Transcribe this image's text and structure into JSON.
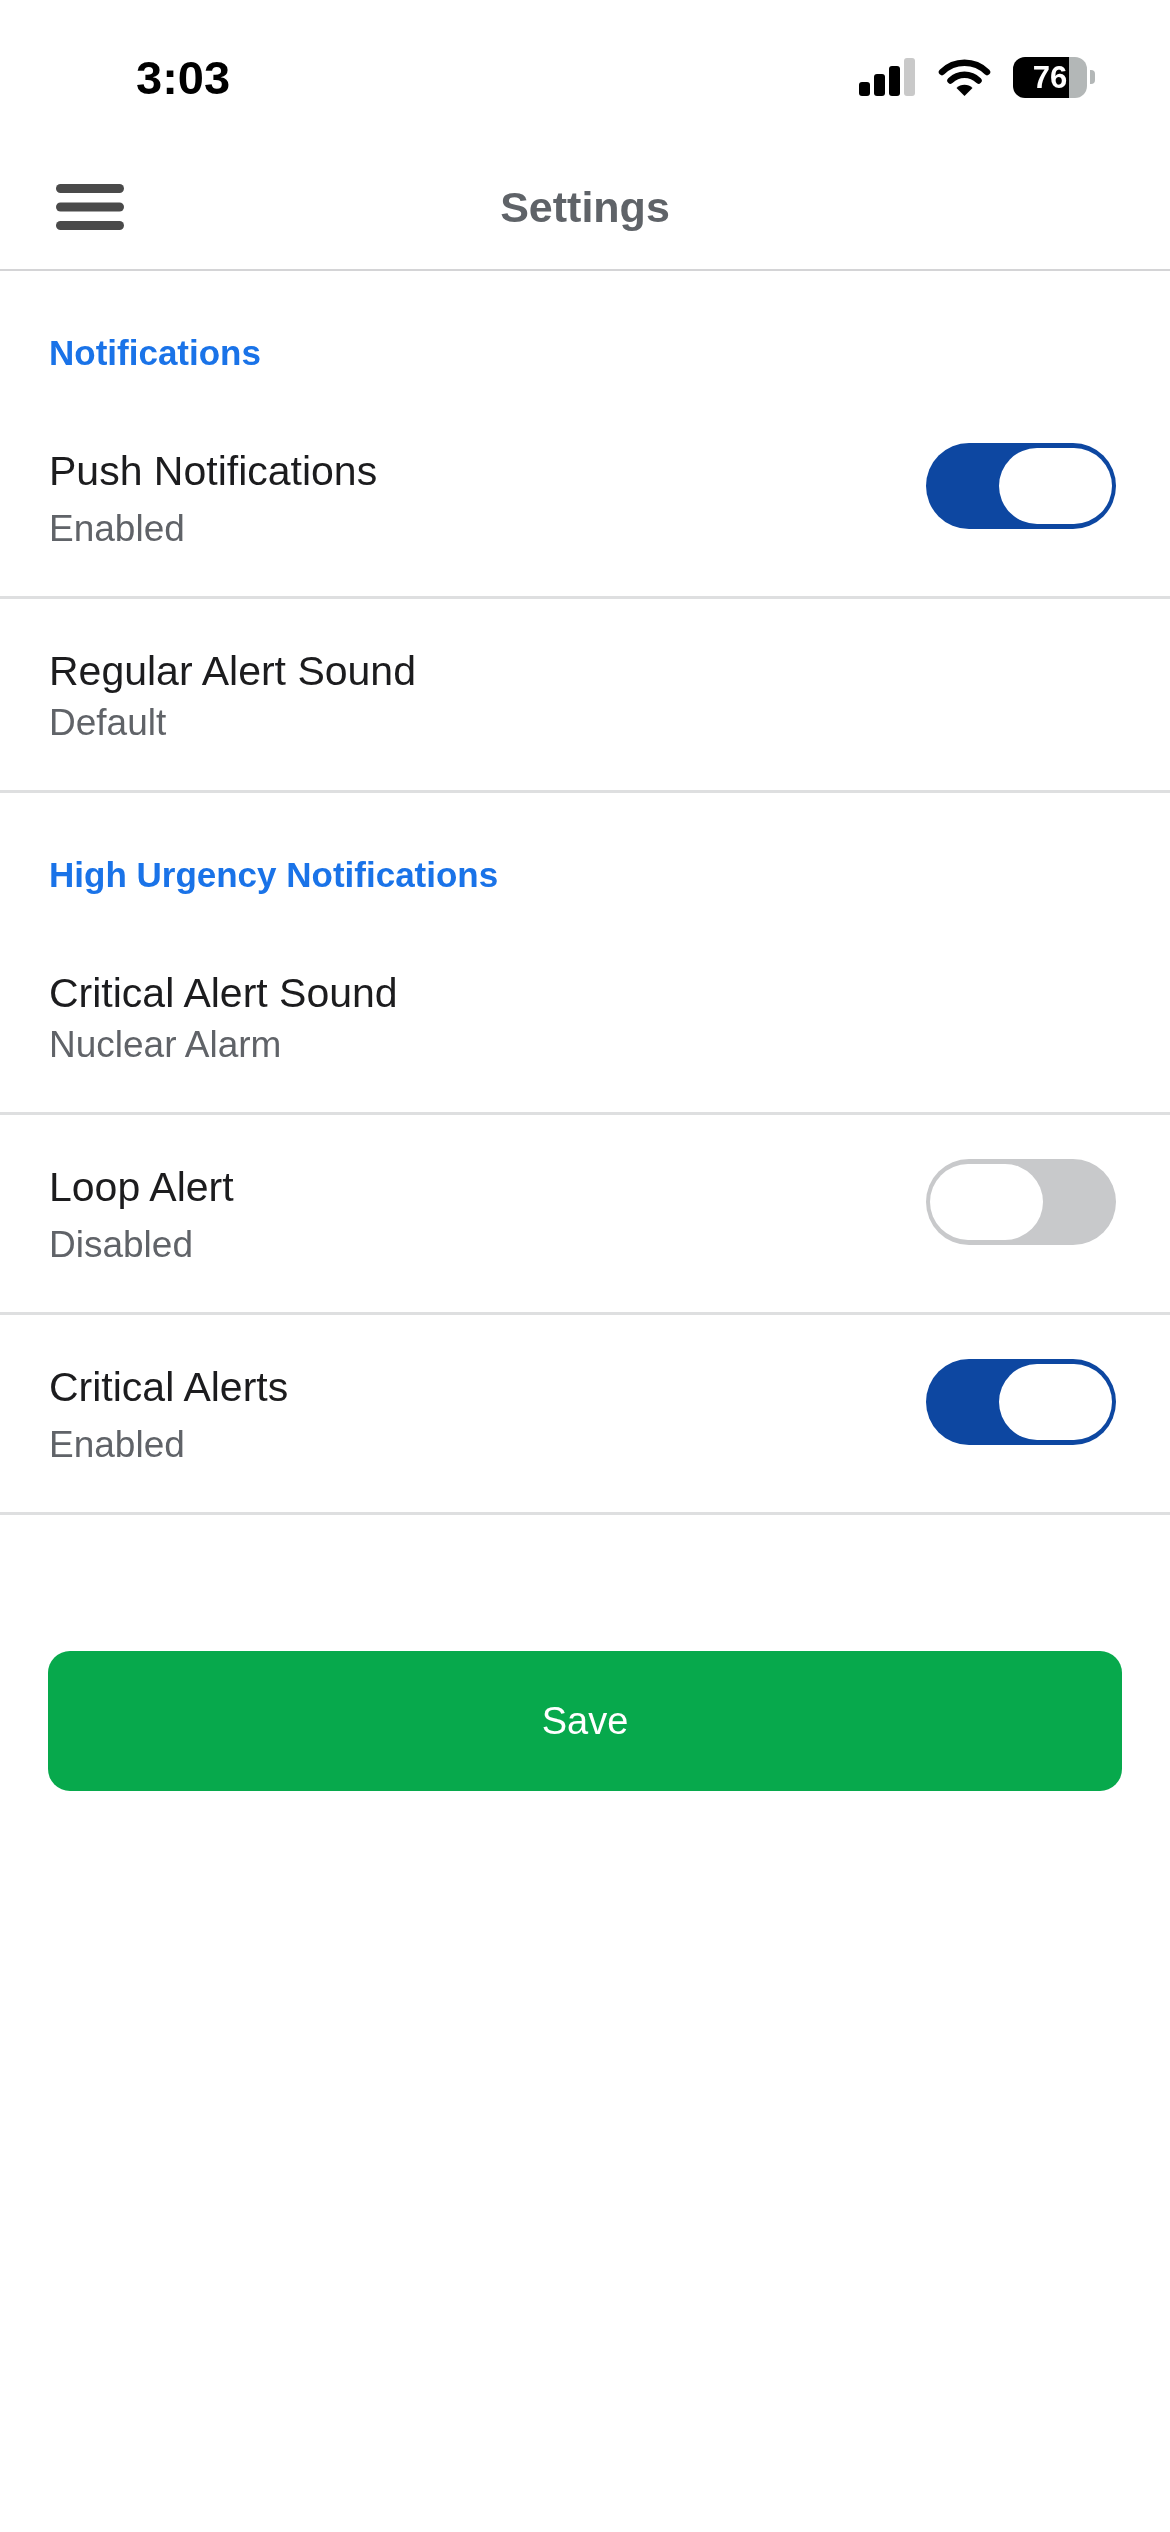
{
  "status_bar": {
    "time": "3:03",
    "battery": "76"
  },
  "header": {
    "title": "Settings"
  },
  "sections": [
    {
      "title": "Notifications",
      "items": [
        {
          "kind": "toggle",
          "label": "Push Notifications",
          "value": "Enabled",
          "on": true
        },
        {
          "kind": "select",
          "label": "Regular Alert Sound",
          "value": "Default"
        }
      ]
    },
    {
      "title": "High Urgency Notifications",
      "items": [
        {
          "kind": "select",
          "label": "Critical Alert Sound",
          "value": "Nuclear Alarm"
        },
        {
          "kind": "toggle",
          "label": "Loop Alert",
          "value": "Disabled",
          "on": false
        },
        {
          "kind": "toggle",
          "label": "Critical Alerts",
          "value": "Enabled",
          "on": true
        }
      ]
    }
  ],
  "save_button": {
    "label": "Save"
  }
}
